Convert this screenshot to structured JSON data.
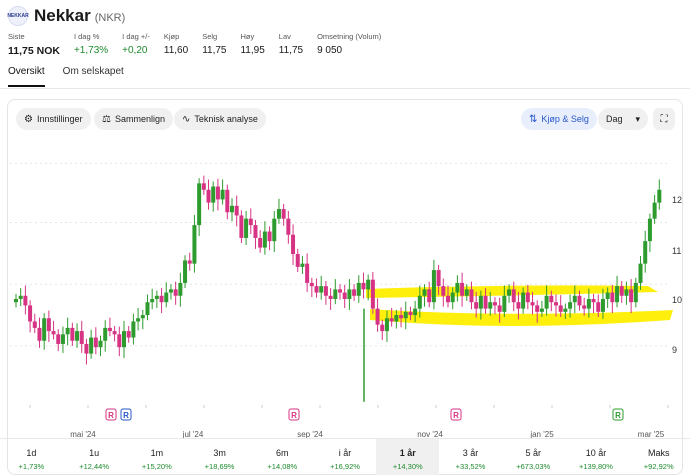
{
  "company": {
    "name": "Nekkar",
    "ticker": "(NKR)",
    "logo_text": "NEKKAR"
  },
  "stats": [
    {
      "label": "Siste",
      "value": "11,75 NOK",
      "style": "big"
    },
    {
      "label": "I dag %",
      "value": "+1,73%",
      "style": "pos"
    },
    {
      "label": "I dag +/-",
      "value": "+0,20",
      "style": "pos"
    },
    {
      "label": "Kjøp",
      "value": "11,60",
      "style": ""
    },
    {
      "label": "Selg",
      "value": "11,75",
      "style": ""
    },
    {
      "label": "Høy",
      "value": "11,95",
      "style": ""
    },
    {
      "label": "Lav",
      "value": "11,75",
      "style": ""
    },
    {
      "label": "Omsetning (Volum)",
      "value": "9 050",
      "style": ""
    }
  ],
  "tabs": [
    "Oversikt",
    "Om selskapet"
  ],
  "toolbar": {
    "settings": "Innstillinger",
    "compare": "Sammenlign",
    "technical": "Teknisk analyse",
    "buy_sell": "Kjøp & Selg",
    "interval": "Dag",
    "interval_caret": "▾",
    "fullscreen": "⛶"
  },
  "colors": {
    "up": "#2e9b2e",
    "down": "#d63384",
    "highlight": "#ffee00",
    "positive_text": "#1f8a2e",
    "buy_sell_blue": "#2757c7"
  },
  "chart_data": {
    "type": "candlestick",
    "x_ticks": [
      "mai '24",
      "jul '24",
      "sep '24",
      "nov '24",
      "jan '25",
      "mar '25"
    ],
    "y_ticks": [
      "12",
      "11",
      "10",
      "9"
    ],
    "ylim": [
      8.4,
      12.4
    ],
    "event_markers": [
      "R",
      "R",
      "R",
      "R",
      "R"
    ],
    "close_series": [
      10.05,
      10.1,
      9.95,
      9.7,
      9.6,
      9.4,
      9.75,
      9.55,
      9.5,
      9.35,
      9.5,
      9.6,
      9.4,
      9.55,
      9.35,
      9.2,
      9.45,
      9.3,
      9.4,
      9.6,
      9.55,
      9.5,
      9.3,
      9.55,
      9.45,
      9.7,
      9.75,
      9.8,
      10.0,
      10.05,
      10.1,
      10.0,
      10.15,
      10.2,
      10.1,
      10.3,
      10.65,
      10.6,
      11.2,
      11.85,
      11.75,
      11.55,
      11.8,
      11.6,
      11.75,
      11.4,
      11.5,
      11.35,
      11.0,
      11.3,
      11.2,
      11.0,
      10.85,
      11.1,
      10.95,
      11.3,
      11.45,
      11.3,
      11.05,
      10.75,
      10.55,
      10.6,
      10.3,
      10.25,
      10.15,
      10.25,
      10.1,
      10.05,
      10.2,
      10.15,
      10.05,
      10.2,
      10.1,
      10.3,
      10.2,
      10.35,
      9.9,
      9.65,
      9.55,
      9.75,
      9.7,
      9.8,
      9.75,
      9.85,
      9.8,
      9.9,
      10.1,
      10.2,
      10.0,
      10.5,
      10.25,
      10.1,
      10.0,
      10.15,
      10.3,
      10.1,
      10.2,
      10.0,
      9.9,
      10.1,
      9.9,
      10.0,
      9.95,
      9.85,
      10.1,
      10.2,
      10.0,
      9.9,
      10.15,
      10.0,
      9.95,
      9.85,
      9.9,
      10.1,
      10.0,
      9.95,
      9.85,
      9.9,
      10.0,
      10.1,
      9.95,
      9.9,
      10.05,
      10.0,
      9.85,
      10.05,
      10.15,
      10.0,
      10.25,
      10.1,
      10.2,
      10.0,
      10.3,
      10.6,
      10.95,
      11.3,
      11.55,
      11.75
    ]
  },
  "periods": [
    {
      "label": "1d",
      "value": "+1,73%",
      "active": false
    },
    {
      "label": "1u",
      "value": "+12,44%",
      "active": false
    },
    {
      "label": "1m",
      "value": "+15,20%",
      "active": false
    },
    {
      "label": "3m",
      "value": "+18,69%",
      "active": false
    },
    {
      "label": "6m",
      "value": "+14,08%",
      "active": false
    },
    {
      "label": "i år",
      "value": "+16,92%",
      "active": false
    },
    {
      "label": "1 år",
      "value": "+14,30%",
      "active": true
    },
    {
      "label": "3 år",
      "value": "+33,52%",
      "active": false
    },
    {
      "label": "5 år",
      "value": "+673,03%",
      "active": false
    },
    {
      "label": "10 år",
      "value": "+139,80%",
      "active": false
    },
    {
      "label": "Maks",
      "value": "+92,92%",
      "active": false
    }
  ]
}
